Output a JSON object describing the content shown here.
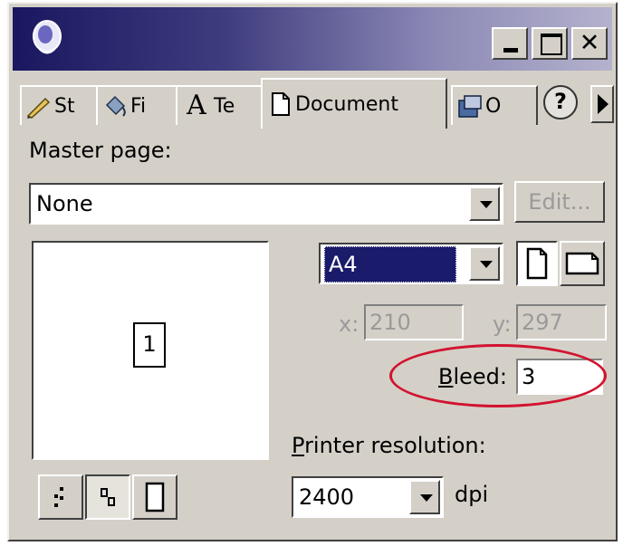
{
  "window": {
    "icons": {
      "app": "corel-balloon-icon",
      "minimize": "minimize-icon",
      "maximize": "maximize-icon",
      "close": "close-icon"
    }
  },
  "tabs": [
    {
      "label": "St",
      "icon": "pencil-icon"
    },
    {
      "label": "Fi",
      "icon": "fill-bucket-icon"
    },
    {
      "label": "Te",
      "icon": "text-icon"
    },
    {
      "label": "Document",
      "icon": "document-icon",
      "active": true
    },
    {
      "label": "O",
      "icon": "objects-icon"
    }
  ],
  "tab_help": "?",
  "master_page": {
    "label": "Master page:",
    "value": "None",
    "edit_label": "Edit..."
  },
  "page_preview": {
    "page_number": "1"
  },
  "page_size": {
    "value": "A4"
  },
  "orientation": {
    "portrait_icon": "portrait-page-icon",
    "landscape_icon": "landscape-page-icon"
  },
  "dimensions": {
    "x_label": "x:",
    "x_value": "210",
    "y_label": "y:",
    "y_value": "297"
  },
  "bleed": {
    "label_first": "B",
    "label_rest": "leed:",
    "value": "3"
  },
  "printer_resolution": {
    "label_first": "P",
    "label_rest": "rinter resolution:",
    "value": "2400",
    "unit": "dpi"
  },
  "view_buttons": [
    "spread-view-icon",
    "facing-pages-icon",
    "single-page-icon"
  ],
  "accent": {
    "highlight_circle": "#d2132f",
    "title_gradient_start": "#1a1760"
  }
}
